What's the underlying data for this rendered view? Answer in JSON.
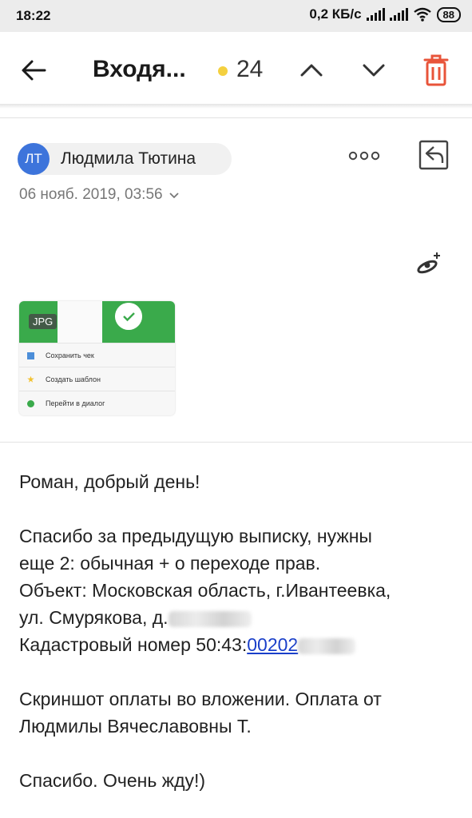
{
  "status_bar": {
    "time": "18:22",
    "network_speed": "0,2 КБ/с",
    "battery": "88"
  },
  "toolbar": {
    "title": "Входя...",
    "unread_count": "24",
    "unread_dot_color": "#f4d03f",
    "delete_color": "#e8543a"
  },
  "message": {
    "sender_initials": "ЛТ",
    "sender_name": "Людмила Тютина",
    "avatar_color": "#3d74db",
    "date": "06 нояб. 2019, 03:56",
    "attachment": {
      "type_badge": "JPG",
      "rows": [
        "Сохранить чек",
        "Создать шаблон",
        "Перейти в диалог"
      ]
    },
    "body": {
      "greeting": "Роман, добрый день!",
      "line1": "Спасибо за предыдущую выписку, нужны",
      "line2": "еще 2: обычная + о переходе прав.",
      "line3": "Объект: Московская область, г.Ивантеевка,",
      "line4_prefix": "ул. Смурякова, д.",
      "line5_prefix": "Кадастровый номер 50:43:",
      "cadastral_link": "00202",
      "line6": "Скриншот оплаты во вложении. Оплата от",
      "line7": "Людмилы Вячеславовны Т.",
      "closing": "Спасибо. Очень жду!)"
    }
  }
}
